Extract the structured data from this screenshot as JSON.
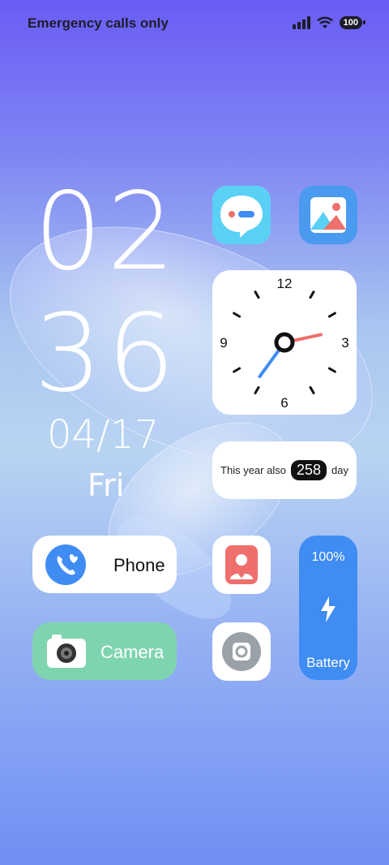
{
  "status_bar": {
    "carrier_text": "Emergency calls only",
    "battery_level": "100",
    "icons": [
      "signal-icon",
      "wifi-icon",
      "battery-icon"
    ]
  },
  "clock": {
    "hours": "02",
    "minutes": "36",
    "date": "04/17",
    "weekday": "Fri"
  },
  "analog_clock": {
    "numbers": [
      "12",
      "3",
      "6",
      "9"
    ],
    "hour": 2,
    "minute": 36
  },
  "day_counter": {
    "prefix": "This year also",
    "value": "258",
    "suffix": "day"
  },
  "apps": {
    "messages": {
      "icon": "messages-icon"
    },
    "gallery": {
      "icon": "gallery-icon"
    },
    "phone": {
      "label": "Phone",
      "icon": "phone-icon"
    },
    "camera": {
      "label": "Camera",
      "icon": "camera-icon"
    },
    "contacts": {
      "icon": "contacts-icon"
    },
    "settings": {
      "icon": "settings-icon"
    }
  },
  "battery_widget": {
    "percent_label": "100%",
    "label": "Battery",
    "icon": "bolt-icon"
  },
  "colors": {
    "phone_icon": "#3f8cf3",
    "camera_bg": "#7fd4b0",
    "battery_bg": "#3f8cf3",
    "contacts_icon": "#ef6f6c",
    "clock_hand_minute": "#3f8cf3",
    "clock_hand_hour": "#ef6f6c"
  }
}
